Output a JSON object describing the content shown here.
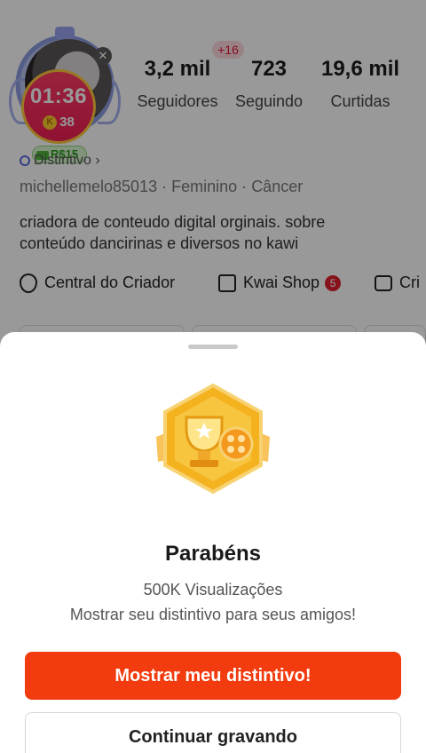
{
  "profile": {
    "timer": {
      "time": "01:36",
      "coins": "38",
      "coin_glyph": "K"
    },
    "cash_badge": "R$15",
    "new_followers_badge": "+16",
    "stats": [
      {
        "value": "3,2 mil",
        "label": "Seguidores"
      },
      {
        "value": "723",
        "label": "Seguindo"
      },
      {
        "value": "19,6 mil",
        "label": "Curtidas"
      }
    ],
    "badge_label": "Distintivo",
    "username": "michellemelo85013",
    "gender": "Feminino",
    "sign": "Câncer",
    "separator": "·",
    "bio_line1": "criadora de conteudo digital orginais. sobre",
    "bio_line2": "conteúdo dancirinas e diversos  no kawi",
    "tools": {
      "creator_center": "Central do Criador",
      "shop": "Kwai Shop",
      "shop_count": "5",
      "third": "Cri"
    }
  },
  "sheet": {
    "title": "Parabéns",
    "milestone": "500K Visualizações",
    "message": "Mostrar seu distintivo para seus amigos!",
    "primary_button": "Mostrar meu distintivo!",
    "secondary_button": "Continuar gravando"
  },
  "colors": {
    "accent": "#f23b0e",
    "timer": "#f01e55",
    "badge_gold": "#f5b21f"
  }
}
